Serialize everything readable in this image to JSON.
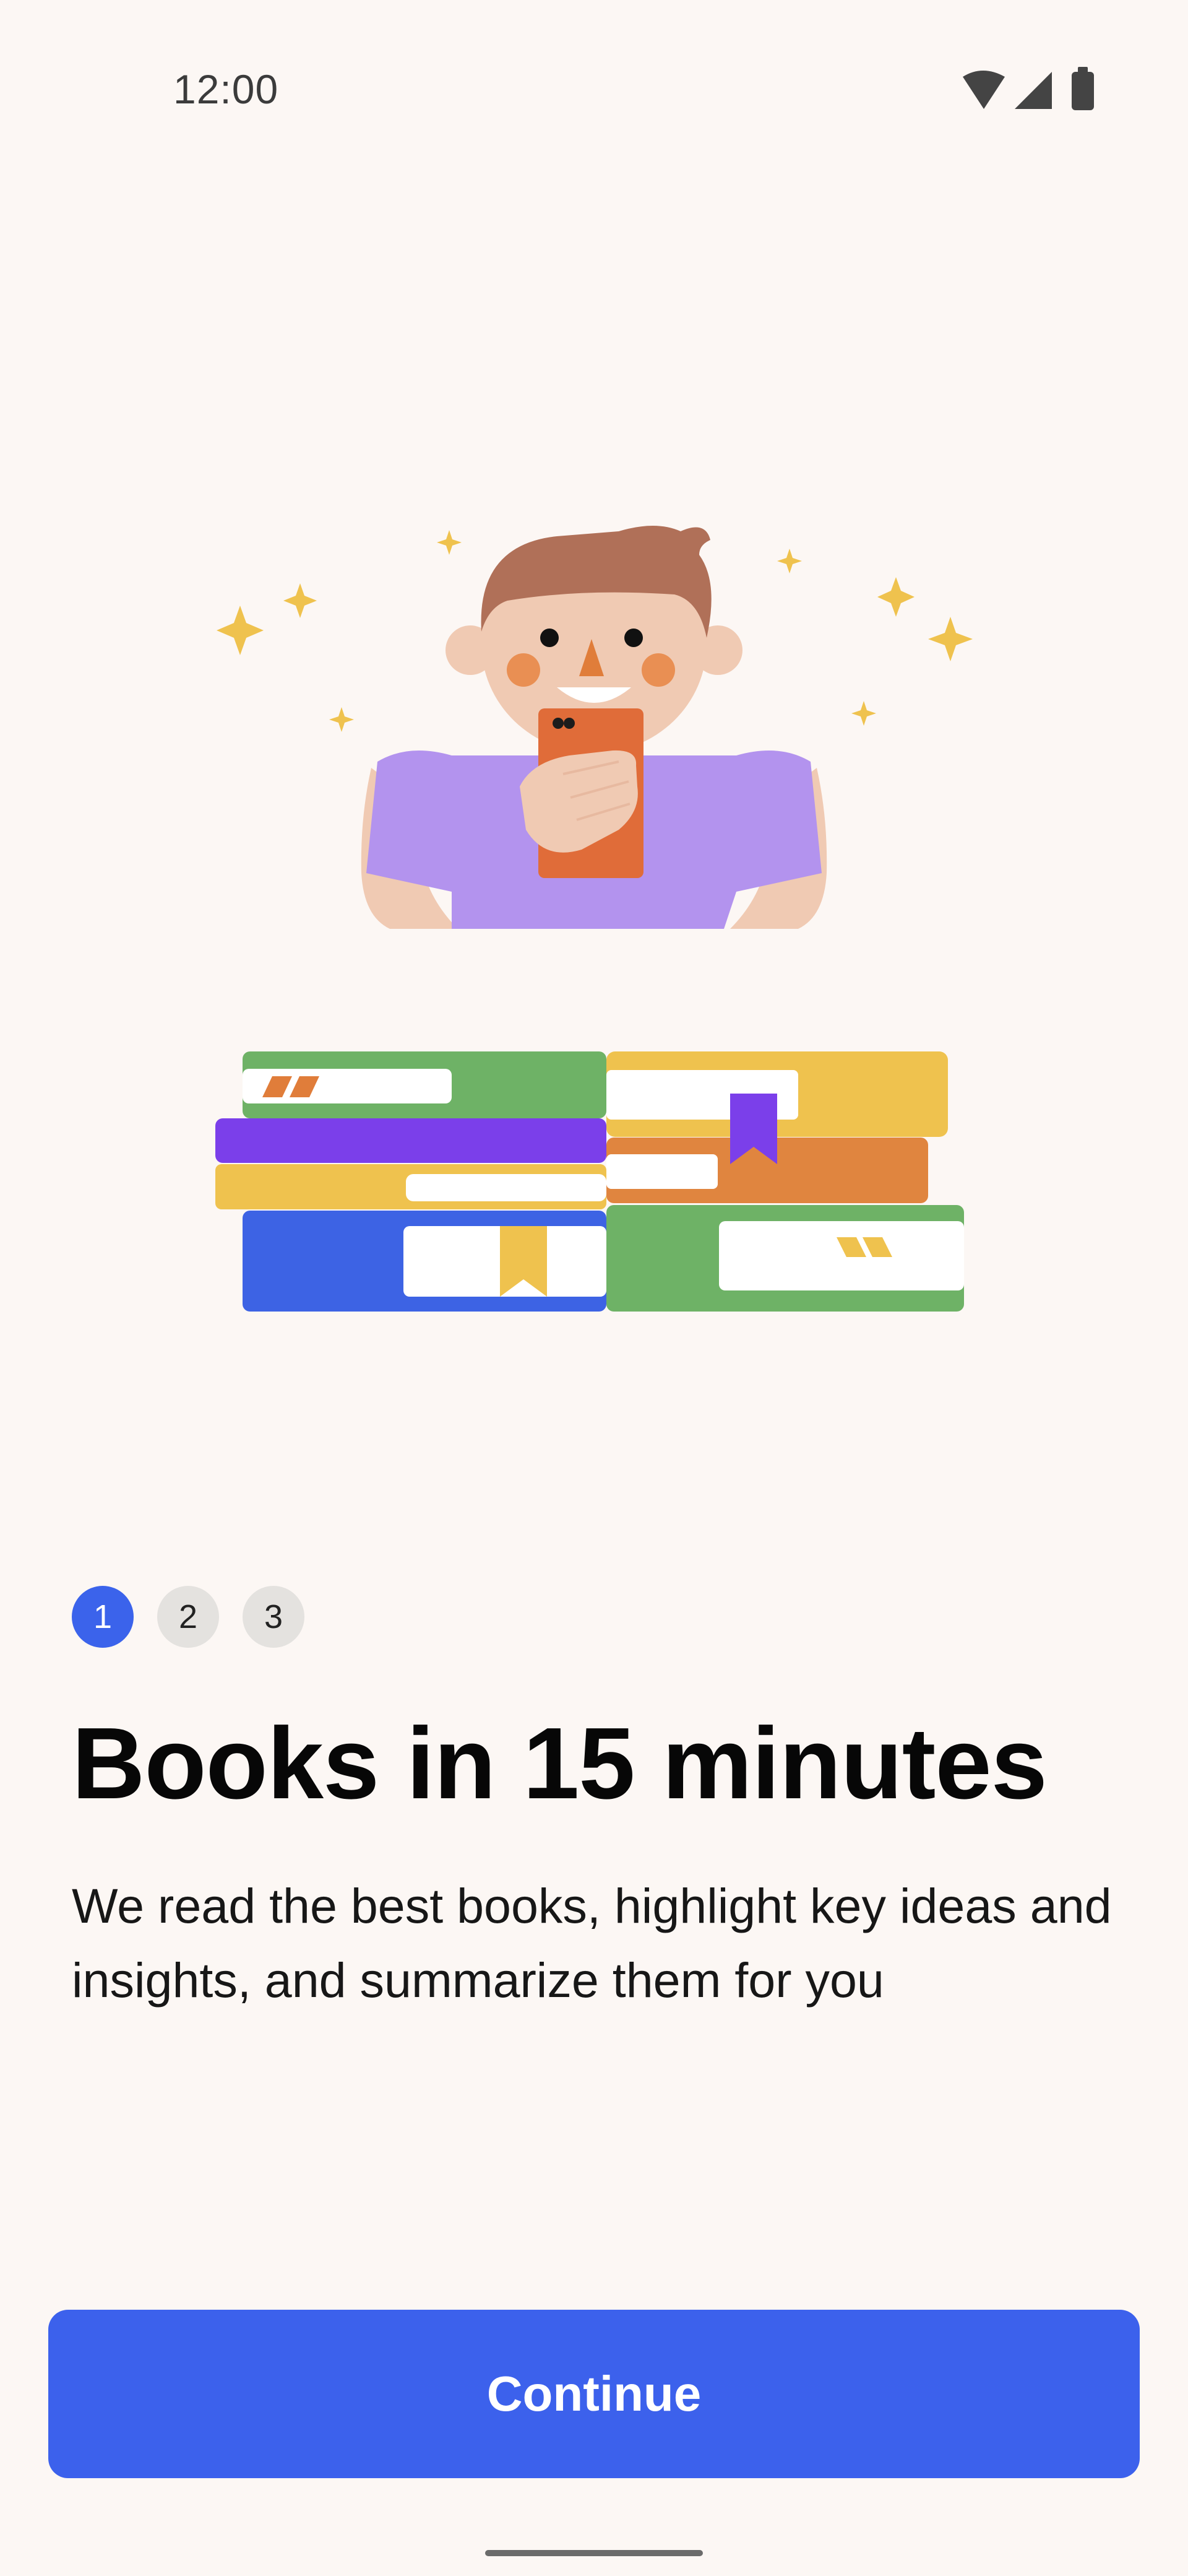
{
  "status_bar": {
    "time": "12:00",
    "icons": [
      "wifi-icon",
      "cellular-signal-icon",
      "battery-icon"
    ]
  },
  "illustration": {
    "subject": "person-reading-phone-with-book-stack"
  },
  "stepper": {
    "steps": [
      "1",
      "2",
      "3"
    ],
    "current_step": 1
  },
  "onboarding": {
    "title": "Books in 15 minutes",
    "subtitle": "We read the best books, highlight key ideas and insights, and summarize them for you"
  },
  "actions": {
    "continue_label": "Continue"
  },
  "colors": {
    "background": "#fcf7f4",
    "accent": "#3c61ec",
    "step_inactive": "#e4e2df"
  }
}
